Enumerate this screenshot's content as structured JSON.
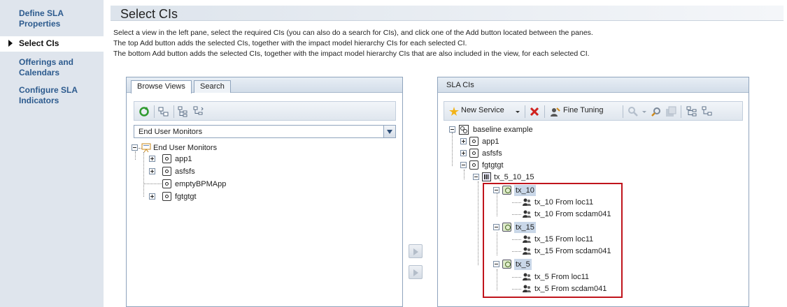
{
  "wizard_nav": {
    "items": [
      {
        "label": "Define SLA\nProperties",
        "active": false
      },
      {
        "label": "Select CIs",
        "active": true
      },
      {
        "label": "Offerings and\nCalendars",
        "active": false
      },
      {
        "label": "Configure SLA\nIndicators",
        "active": false
      }
    ]
  },
  "page": {
    "title": "Select CIs",
    "desc_line1": "Select a view in the left pane, select the required CIs (you can also do a search for CIs), and click one of the Add button located between the panes.",
    "desc_line2": "The top Add button adds the selected CIs, together with the impact model hierarchy CIs for each selected CI.",
    "desc_line3": "The bottom Add button adds the selected CIs, together with the impact model hierarchy CIs that are also included in the view, for each selected CI."
  },
  "left_panel": {
    "tabs": [
      "Browse Views",
      "Search"
    ],
    "active_tab": "Browse Views",
    "view_select": "End User Monitors",
    "tree": {
      "root": "End User Monitors",
      "children": [
        "app1",
        "asfsfs",
        "emptyBPMApp",
        "fgtgtgt"
      ]
    }
  },
  "right_panel": {
    "title": "SLA CIs",
    "toolbar": {
      "new_service": "New Service",
      "fine_tuning": "Fine Tuning"
    },
    "tree": {
      "root": "baseline example",
      "level1": [
        "app1",
        "asfsfs",
        "fgtgtgt"
      ],
      "group": "tx_5_10_15",
      "transactions": [
        {
          "name": "tx_10",
          "children": [
            "tx_10 From loc11",
            "tx_10 From scdam041"
          ]
        },
        {
          "name": "tx_15",
          "children": [
            "tx_15 From loc11",
            "tx_15 From scdam041"
          ]
        },
        {
          "name": "tx_5",
          "children": [
            "tx_5 From loc11",
            "tx_5 From scdam041"
          ]
        }
      ]
    }
  },
  "colors": {
    "nav_bg": "#dfe5ed",
    "nav_link": "#2d5b8e",
    "highlight_box": "#c0141c"
  }
}
